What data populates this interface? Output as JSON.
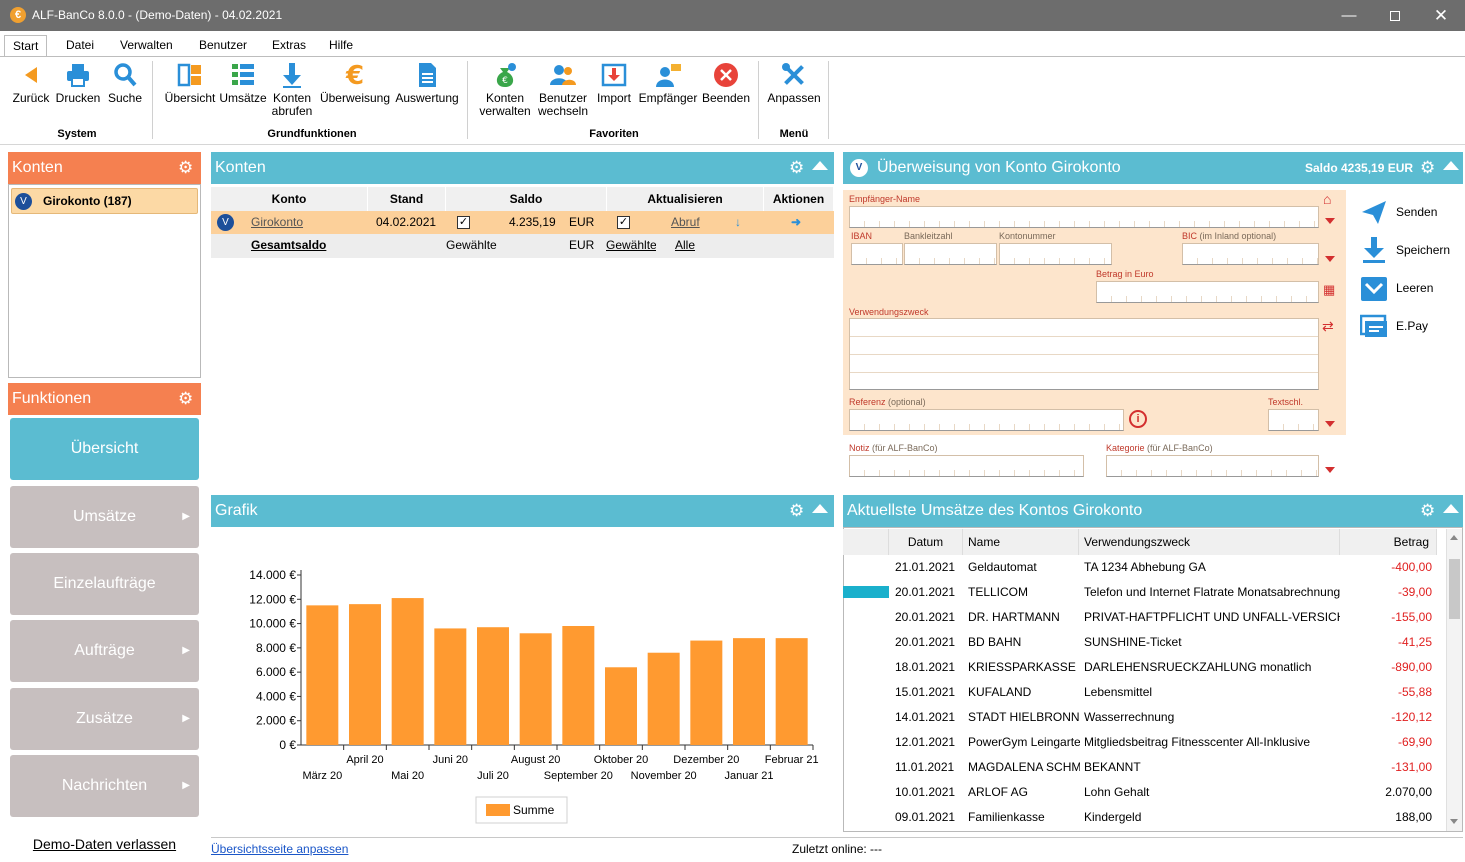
{
  "window": {
    "title": "ALF-BanCo 8.0.0 - (Demo-Daten)  -  04.02.2021",
    "app_letter": "€"
  },
  "ribbon": {
    "tabs": [
      "Start",
      "Datei",
      "Verwalten",
      "Benutzer",
      "Extras",
      "Hilfe"
    ],
    "system": {
      "label": "System",
      "back": "Zurück",
      "print": "Drucken",
      "search": "Suche"
    },
    "grund": {
      "label": "Grundfunktionen",
      "overview": "Übersicht",
      "umsaetze": "Umsätze",
      "konten1": "Konten",
      "konten2": "abrufen",
      "transfer": "Überweisung",
      "auswertung": "Auswertung"
    },
    "favoriten": {
      "label": "Favoriten",
      "kv1": "Konten",
      "kv2": "verwalten",
      "bw1": "Benutzer",
      "bw2": "wechseln",
      "import": "Import",
      "empfaenger": "Empfänger",
      "beenden": "Beenden"
    },
    "menu": {
      "label": "Menü",
      "anpassen": "Anpassen"
    }
  },
  "left": {
    "konten_title": "Konten",
    "account_item": "Girokonto (187)",
    "funktionen_title": "Funktionen",
    "functions": [
      "Übersicht",
      "Umsätze",
      "Einzelaufträge",
      "Aufträge",
      "Zusätze",
      "Nachrichten"
    ],
    "leave_demo": "Demo-Daten verlassen"
  },
  "konten_panel": {
    "title": "Konten",
    "headers": [
      "Konto",
      "Stand",
      "Saldo",
      "Aktualisieren",
      "Aktionen"
    ],
    "row": {
      "name": "Girokonto",
      "date": "04.02.2021",
      "saldo": "4.235,19",
      "currency": "EUR",
      "abruf": "Abruf"
    },
    "total": {
      "label": "Gesamtsaldo",
      "gewaehlte": "Gewählte",
      "currency": "EUR",
      "gewaehlte_link": "Gewählte",
      "alle": "Alle"
    }
  },
  "transfer": {
    "title": "Überweisung von Konto Girokonto",
    "saldo": "Saldo 4235,19 EUR",
    "empfaenger": "Empfänger-Name",
    "iban": "IBAN",
    "blz": "Bankleitzahl",
    "kontonummer": "Kontonummer",
    "bic": "BIC",
    "bic_note": "(im Inland optional)",
    "betrag": "Betrag in Euro",
    "zweck": "Verwendungszweck",
    "referenz": "Referenz",
    "referenz_note": "(optional)",
    "textschl": "Textschl.",
    "notiz": "Notiz",
    "notiz_note": "(für ALF-BanCo)",
    "kategorie": "Kategorie",
    "kategorie_note": "(für ALF-BanCo)",
    "actions": {
      "send": "Senden",
      "save": "Speichern",
      "clear": "Leeren",
      "epay": "E.Pay"
    }
  },
  "grafik": {
    "title": "Grafik"
  },
  "chart_data": {
    "type": "bar",
    "categories": [
      "März 20",
      "April 20",
      "Mai 20",
      "Juni 20",
      "Juli 20",
      "August 20",
      "September 20",
      "Oktober 20",
      "November 20",
      "Dezember 20",
      "Januar 21",
      "Februar 21"
    ],
    "series": [
      {
        "name": "Summe",
        "values": [
          11500,
          11600,
          12100,
          9600,
          9700,
          9200,
          9800,
          6400,
          7600,
          8600,
          8800,
          8800
        ]
      }
    ],
    "yticks": [
      "0 €",
      "2.000 €",
      "4.000 €",
      "6.000 €",
      "8.000 €",
      "10.000 €",
      "12.000 €",
      "14.000 €"
    ],
    "ylim": [
      0,
      14000
    ],
    "color": "#ff9a30",
    "legend": "bottom",
    "grid": false
  },
  "umsaetze": {
    "title": "Aktuellste Umsätze des Kontos Girokonto",
    "headers": [
      "Datum",
      "Name",
      "Verwendungszweck",
      "Betrag"
    ],
    "rows": [
      {
        "date": "21.01.2021",
        "name": "Geldautomat",
        "zweck": "TA 1234 Abhebung GA",
        "betrag": "-400,00",
        "neg": true
      },
      {
        "date": "20.01.2021",
        "name": "TELLICOM",
        "zweck": "Telefon und Internet Flatrate Monatsabrechnung",
        "betrag": "-39,00",
        "neg": true
      },
      {
        "date": "20.01.2021",
        "name": "DR. HARTMANN",
        "zweck": "PRIVAT-HAFTPFLICHT UND UNFALL-VERSICHERUNG",
        "betrag": "-155,00",
        "neg": true
      },
      {
        "date": "20.01.2021",
        "name": "BD BAHN",
        "zweck": "SUNSHINE-Ticket",
        "betrag": "-41,25",
        "neg": true
      },
      {
        "date": "18.01.2021",
        "name": "KRIESSPARKASSE",
        "zweck": "DARLEHENSRUECKZAHLUNG monatlich",
        "betrag": "-890,00",
        "neg": true
      },
      {
        "date": "15.01.2021",
        "name": "KUFALAND",
        "zweck": "Lebensmittel",
        "betrag": "-55,88",
        "neg": true
      },
      {
        "date": "14.01.2021",
        "name": "STADT HIELBRONN",
        "zweck": "Wasserrechnung",
        "betrag": "-120,12",
        "neg": true
      },
      {
        "date": "12.01.2021",
        "name": "PowerGym Leingarten",
        "zweck": "Mitgliedsbeitrag Fitnesscenter All-Inklusive",
        "betrag": "-69,90",
        "neg": true
      },
      {
        "date": "11.01.2021",
        "name": "MAGDALENA SCHMIDT",
        "zweck": "BEKANNT",
        "betrag": "-131,00",
        "neg": true
      },
      {
        "date": "10.01.2021",
        "name": "ARLOF AG",
        "zweck": "Lohn Gehalt",
        "betrag": "2.070,00",
        "neg": false
      },
      {
        "date": "09.01.2021",
        "name": "Familienkasse",
        "zweck": "Kindergeld",
        "betrag": "188,00",
        "neg": false
      }
    ]
  },
  "footer": {
    "link": "Übersichtsseite anpassen",
    "status": "Zuletzt online: ---"
  },
  "colors": {
    "accent_blue": "#5bbcd1",
    "accent_orange": "#f58050",
    "form_bg": "#fde5cc",
    "negative": "#e02020"
  }
}
